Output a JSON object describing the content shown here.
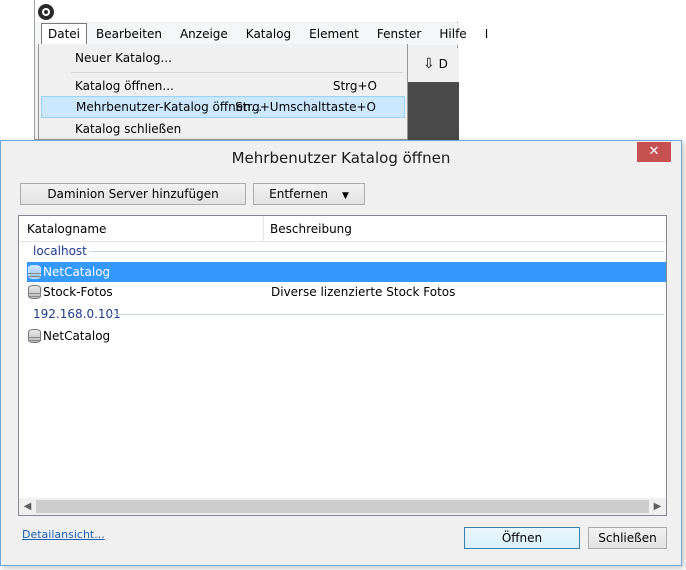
{
  "app": {
    "menus": [
      "Datei",
      "Bearbeiten",
      "Anzeige",
      "Katalog",
      "Element",
      "Fenster",
      "Hilfe",
      "I"
    ],
    "toolbar_partial": "D"
  },
  "file_menu": {
    "items": [
      {
        "label": "Neuer Katalog...",
        "shortcut": ""
      },
      {
        "label": "Katalog öffnen...",
        "shortcut": "Strg+O"
      },
      {
        "label": "Mehrbenutzer-Katalog öffnen...",
        "shortcut": "Strg+Umschalttaste+O"
      },
      {
        "label": "Katalog schließen",
        "shortcut": ""
      }
    ]
  },
  "dialog": {
    "title": "Mehrbenutzer Katalog öffnen",
    "close_glyph": "✕",
    "add_server_label": "Daminion Server hinzufügen",
    "remove_label": "Entfernen",
    "columns": [
      "Katalogname",
      "Beschreibung"
    ],
    "groups": [
      {
        "name": "localhost",
        "rows": [
          {
            "name": "NetCatalog",
            "description": "",
            "selected": true
          },
          {
            "name": "Stock-Fotos",
            "description": "Diverse lizenzierte Stock Fotos",
            "selected": false
          }
        ]
      },
      {
        "name": "192.168.0.101",
        "rows": [
          {
            "name": "NetCatalog",
            "description": "",
            "selected": false
          }
        ]
      }
    ],
    "details_link": "Detailansicht...",
    "open_label": "Öffnen",
    "close_label": "Schließen"
  },
  "colors": {
    "selection": "#3399ff",
    "highlight_menu": "#cce8ff",
    "close_button": "#c75050",
    "group_text": "#1e3b8e"
  }
}
